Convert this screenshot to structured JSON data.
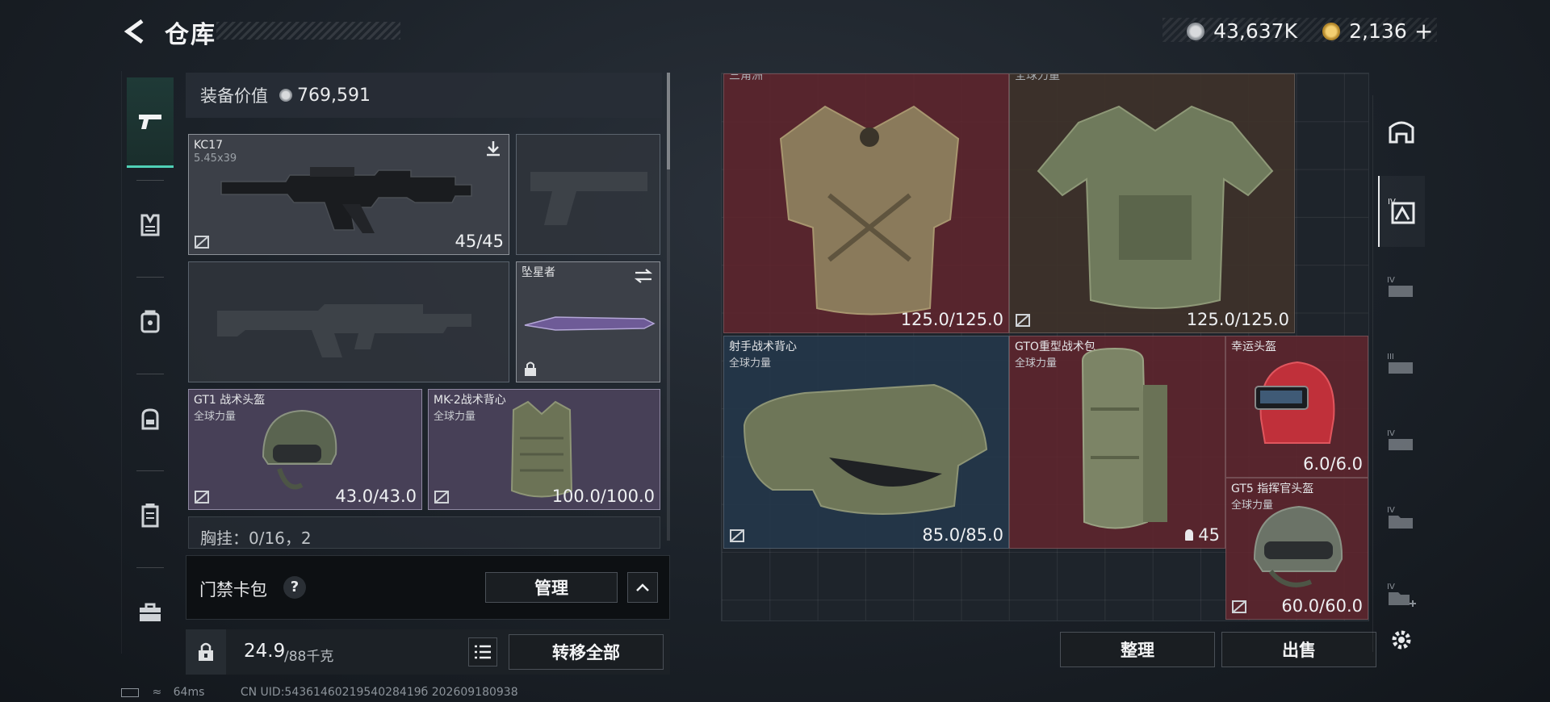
{
  "header": {
    "title": "仓库",
    "currency_silver": "43,637K",
    "currency_gold": "2,136"
  },
  "equip_value": {
    "label": "装备价值",
    "value": "769,591"
  },
  "loadout": {
    "primary": {
      "name": "KC17",
      "caliber": "5.45x39",
      "durability": "45/45"
    },
    "melee": {
      "name": "坠星者"
    },
    "helmet": {
      "name": "GT1 战术头盔",
      "source": "全球力量",
      "durability": "43.0/43.0"
    },
    "armor": {
      "name": "MK-2战术背心",
      "source": "全球力量",
      "durability": "100.0/100.0"
    },
    "chest_rig": {
      "label": "胸挂：0/16，2"
    }
  },
  "card_bag": {
    "label": "门禁卡包",
    "help": "?",
    "manage_label": "管理"
  },
  "bottom": {
    "weight": "24.9",
    "weight_max": "/88千克",
    "transfer_all_label": "转移全部"
  },
  "stash": {
    "items": [
      {
        "name": "三角洲",
        "sub": "",
        "durability": "125.0/125.0"
      },
      {
        "name": "全球力量",
        "sub": "",
        "durability": "125.0/125.0"
      },
      {
        "name": "射手战术背心",
        "sub": "全球力量",
        "durability": "85.0/85.0"
      },
      {
        "name": "GTO重型战术包",
        "sub": "全球力量",
        "count": "45"
      },
      {
        "name": "幸运头盔",
        "sub": "",
        "durability": "6.0/6.0"
      },
      {
        "name": "GT5 指挥官头盔",
        "sub": "全球力量",
        "durability": "60.0/60.0"
      }
    ],
    "organize_label": "整理",
    "sell_label": "出售"
  },
  "footer": {
    "ping": "64ms",
    "uid": "CN UID:5436146021954028419б 202609180938"
  },
  "colors": {
    "accent": "#4fd0b6",
    "red_rarity": "#60262e",
    "purple_rarity": "#474057",
    "blue_rarity": "#24374a"
  }
}
